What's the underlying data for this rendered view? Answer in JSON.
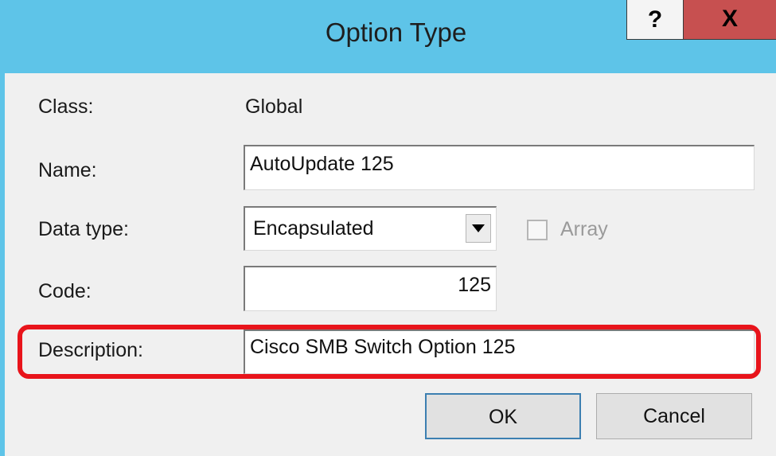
{
  "window": {
    "title": "Option Type",
    "help_label": "?",
    "close_label": "X"
  },
  "fields": {
    "class_label": "Class:",
    "class_value": "Global",
    "name_label": "Name:",
    "name_value": "AutoUpdate 125",
    "datatype_label": "Data type:",
    "datatype_value": "Encapsulated",
    "array_label": "Array",
    "array_checked": false,
    "code_label": "Code:",
    "code_value": "125",
    "description_label": "Description:",
    "description_value": "Cisco SMB Switch Option 125"
  },
  "buttons": {
    "ok_label": "OK",
    "cancel_label": "Cancel"
  },
  "colors": {
    "titlebar": "#5ec4e8",
    "close_button": "#c75050",
    "highlight": "#e8141b"
  }
}
